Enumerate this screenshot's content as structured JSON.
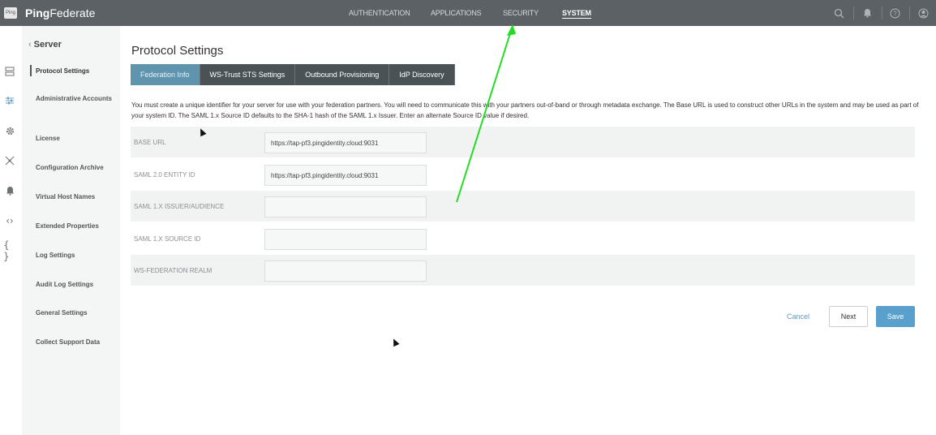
{
  "app": {
    "logo_text": "Ping",
    "brand_bold": "Ping",
    "brand_rest": "Federate"
  },
  "topnav": {
    "items": [
      "AUTHENTICATION",
      "APPLICATIONS",
      "SECURITY",
      "SYSTEM"
    ],
    "active": "SYSTEM"
  },
  "topbar_icons": [
    "search-icon",
    "bell-icon",
    "help-icon",
    "user-icon"
  ],
  "rail_icons": [
    "server-icon",
    "sliders-icon",
    "gear-icon",
    "network-icon",
    "bell-icon",
    "code-icon",
    "braces-icon"
  ],
  "sidenav": {
    "back_label": "Server",
    "items": [
      "Protocol Settings",
      "Administrative Accounts",
      "License",
      "Configuration Archive",
      "Virtual Host Names",
      "Extended Properties",
      "Log Settings",
      "Audit Log Settings",
      "General Settings",
      "Collect Support Data"
    ],
    "active": "Protocol Settings"
  },
  "page": {
    "title": "Protocol Settings",
    "tabs": [
      "Federation Info",
      "WS-Trust STS Settings",
      "Outbound Provisioning",
      "IdP Discovery"
    ],
    "active_tab": "Federation Info",
    "description": "You must create a unique identifier for your server for use with your federation partners. You will need to communicate this with your partners out-of-band or through metadata exchange. The Base URL is used to construct other URLs in the system and may be used as part of your system ID. The SAML 1.x Source ID defaults to the SHA-1 hash of the SAML 1.x Issuer. Enter an alternate Source ID value if desired.",
    "fields": [
      {
        "label": "BASE URL",
        "value": "https://tap-pf3.pingidentity.cloud:9031"
      },
      {
        "label": "SAML 2.0 ENTITY ID",
        "value": "https://tap-pf3.pingidentity.cloud:9031"
      },
      {
        "label": "SAML 1.X ISSUER/AUDIENCE",
        "value": ""
      },
      {
        "label": "SAML 1.X SOURCE ID",
        "value": ""
      },
      {
        "label": "WS-FEDERATION REALM",
        "value": ""
      }
    ],
    "buttons": {
      "cancel": "Cancel",
      "next": "Next",
      "save": "Save"
    }
  },
  "colors": {
    "topbar": "#5b6164",
    "tab": "#4b5255",
    "tab_active": "#5e94ae",
    "save": "#5aa0cc",
    "annotation_arrow": "#22dd22"
  }
}
